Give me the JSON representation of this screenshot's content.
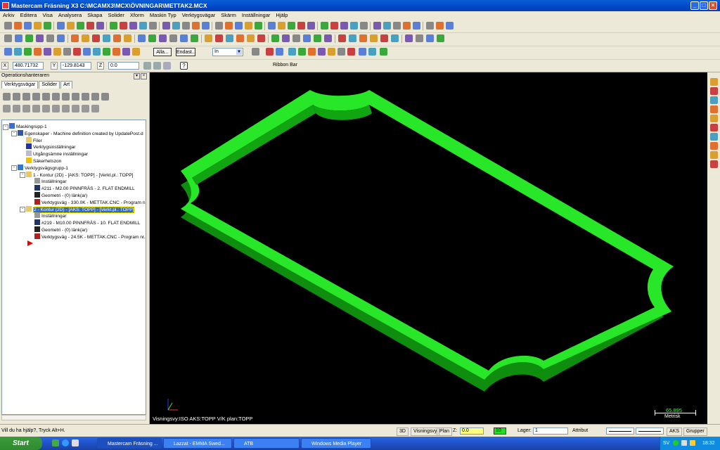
{
  "titlebar": {
    "title": "Mastercam Fräsning X3  C:\\MCAMX3\\MCX\\ÖVNINGAR\\METTAK2.MCX"
  },
  "menu": [
    "Arkiv",
    "Editera",
    "Visa",
    "Analysera",
    "Skapa",
    "Solider",
    "Xform",
    "Maskin Typ",
    "Verktygsvägar",
    "Skärm",
    "Inställningar",
    "Hjälp"
  ],
  "toolbar3": {
    "all_label": "Alla...",
    "only_label": "Endast...",
    "unit_value": "In"
  },
  "ribbon": {
    "x_label": "X",
    "x_value": "480.71732",
    "y_label": "Y",
    "y_value": "-129.8143",
    "z_label": "Z",
    "z_value": "0.0",
    "title": "Ribbon Bar"
  },
  "panel": {
    "header": "Operationshanteraren",
    "tabs": [
      "Verktygsvägar",
      "Solider",
      "Art"
    ],
    "tree": [
      "Maskingrupp-1",
      "Egenskaper - Machine definition created by UpdatePost.d",
      "Filer",
      "Verktygsinställningar",
      "Utgångsämne inställningar",
      "Säkerhetszon",
      "Verktygsvägsgrupp-1",
      "1 - Kontur (2D) - [AKS: TOPP] - [Verkt.pl.: TOPP]",
      "Inställningar",
      "#211 - M2.00 PINNFRÄS -     2. FLAT ENDMILL",
      "Geometri - (0) länk(ar)",
      "Verktygsväg - 330.0K - METTAK.CNC - Program n",
      "2 - Kontur (2D) - [AKS: TOPP] - [Verkt.pl.: TOPP]",
      "Inställningar",
      "#219 - M10.00 PINNFRÄS -     10. FLAT ENDMILL",
      "Geometri - (0) länk(ar)",
      "Verktygsväg - 24.5K - METTAK.CNC - Program nr."
    ]
  },
  "viewport": {
    "status": "Visningsvy:ISO    AKS:TOPP    V/K plan:TOPP",
    "scale_value": "65.895",
    "scale_unit": "Metrisk"
  },
  "statusbar": {
    "help": "Vill du ha hjälp?, Tryck Alt+H.",
    "mode_3d": "3D",
    "view_btn": "Visningsvy",
    "plan_btn": "Plan",
    "z_label": "Z:",
    "z_value": "0.0",
    "color_value": "10",
    "layer_label": "Lager:",
    "layer_value": "1",
    "attr_label": "Attribut",
    "aks_btn": "AKS",
    "groups_btn": "Grupper"
  },
  "taskbar": {
    "start": "Start",
    "tasks": [
      "Mastercam Fräsning ...",
      "Lazzat - EMMA Swed...",
      "ATB",
      "Windows Media Player"
    ],
    "lang": "SV",
    "clock": "18:32"
  },
  "colors": {
    "part": "#22dd22",
    "selection": "#316ac5",
    "taskbar": "#245edb"
  }
}
